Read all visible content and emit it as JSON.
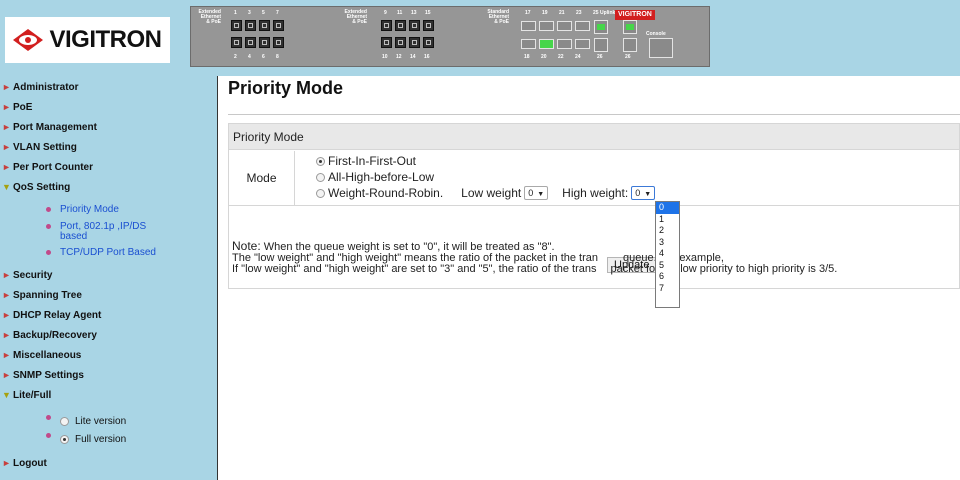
{
  "header": {
    "logo_text": "VIGITRON",
    "panel_logo": "VIGITRON",
    "group1_label": [
      "Extended",
      "Ethernet",
      "& PoE"
    ],
    "group1_top_numbers": [
      "1",
      "3",
      "5",
      "7"
    ],
    "group1_bottom_numbers": [
      "2",
      "4",
      "6",
      "8"
    ],
    "group2_label": [
      "Extended",
      "Ethernet",
      "& PoE"
    ],
    "group2_top_numbers": [
      "9",
      "11",
      "13",
      "15"
    ],
    "group2_bottom_numbers": [
      "10",
      "12",
      "14",
      "16"
    ],
    "group3_label": [
      "Standard",
      "Ethernet",
      "& PoE"
    ],
    "group3_top_numbers": [
      "17",
      "19",
      "21",
      "23",
      "25"
    ],
    "group3_bottom_numbers": [
      "18",
      "20",
      "22",
      "24",
      "26"
    ],
    "uplink_label": "Uplink",
    "uplink_top": "25",
    "uplink_bottom": "26",
    "console_label": "Console"
  },
  "sidebar": {
    "items": [
      {
        "label": "Administrator",
        "open": false
      },
      {
        "label": "PoE",
        "open": false
      },
      {
        "label": "Port Management",
        "open": false
      },
      {
        "label": "VLAN Setting",
        "open": false
      },
      {
        "label": "Per Port Counter",
        "open": false
      },
      {
        "label": "QoS Setting",
        "open": true
      },
      {
        "label": "Security",
        "open": false
      },
      {
        "label": "Spanning Tree",
        "open": false
      },
      {
        "label": "DHCP Relay Agent",
        "open": false
      },
      {
        "label": "Backup/Recovery",
        "open": false
      },
      {
        "label": "Miscellaneous",
        "open": false
      },
      {
        "label": "SNMP Settings",
        "open": false
      },
      {
        "label": "Lite/Full",
        "open": true
      },
      {
        "label": "Logout",
        "open": false
      }
    ],
    "qos_sub": [
      "Priority Mode",
      "Port, 802.1p ,IP/DS",
      "based",
      "TCP/UDP Port Based"
    ],
    "lite_full": {
      "lite": "Lite version",
      "full": "Full version",
      "selected": "full"
    }
  },
  "main": {
    "title": "Priority Mode",
    "table_header": "Priority Mode",
    "mode_label": "Mode",
    "options": [
      "First-In-First-Out",
      "All-High-before-Low",
      "Weight-Round-Robin."
    ],
    "selected_option": 0,
    "low_weight_label": "Low weight",
    "low_weight_value": "0",
    "high_weight_label": "High weight:",
    "high_weight_value": "0",
    "update_label": "Update",
    "note_label": "Note:",
    "note_line1": " When the queue weight is set to \"0\", it will be treated as \"8\".",
    "note_line2": "The \"low weight\" and \"high weight\" means the ratio of the packet in the tran",
    "note_line2b": " queue. For example,",
    "note_line3": "If \"low weight\" and \"high weight\" are set to \"3\" and \"5\", the ratio of the trans",
    "note_line3b": "packet for the low priority to high priority is 3/5.",
    "dropdown_options": [
      "0",
      "1",
      "2",
      "3",
      "4",
      "5",
      "6",
      "7"
    ],
    "dropdown_selected": 0
  }
}
